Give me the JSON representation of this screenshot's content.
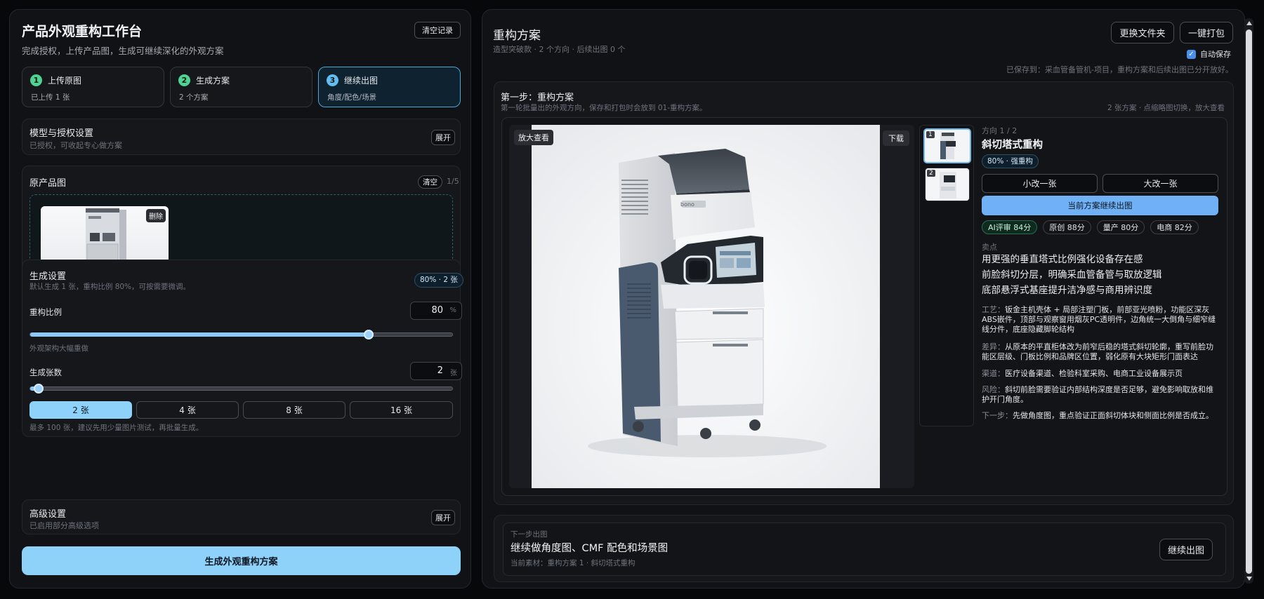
{
  "left": {
    "title": "产品外观重构工作台",
    "subtitle": "完成授权，上传产品图，生成可继续深化的外观方案",
    "clear_history": "清空记录",
    "steps": [
      {
        "num": "1",
        "title": "上传原图",
        "sub": "已上传 1 张"
      },
      {
        "num": "2",
        "title": "生成方案",
        "sub": "2 个方案"
      },
      {
        "num": "3",
        "title": "继续出图",
        "sub": "角度/配色/场景"
      }
    ],
    "model": {
      "title": "模型与授权设置",
      "sub": "已授权，可收起专心做方案",
      "expand": "展开"
    },
    "original": {
      "title": "原产品图",
      "clear": "清空",
      "count": "1/5",
      "delete": "删除"
    },
    "gen": {
      "title": "生成设置",
      "sub": "默认生成 1 张，重构比例 80%，可按需要微调。",
      "badge": "80% · 2 张",
      "ratio_label": "重构比例",
      "ratio_value": "80",
      "ratio_unit": "%",
      "ratio_fraction": 0.8,
      "ratio_hint": "外观架构大幅重做",
      "count_label": "生成张数",
      "count_value": "2",
      "count_unit": "张",
      "count_fraction": 0.02,
      "qty_options": [
        "2 张",
        "4 张",
        "8 张",
        "16 张"
      ],
      "qty_selected": 0,
      "note": "最多 100 张，建议先用少量图片测试，再批量生成。"
    },
    "advanced": {
      "title": "高级设置",
      "sub": "已启用部分高级选项",
      "expand": "展开"
    },
    "generate_button": "生成外观重构方案"
  },
  "right": {
    "title": "重构方案",
    "subtitle": "造型突破款 · 2 个方向 · 后续出图 0 个",
    "change_folder": "更换文件夹",
    "pack": "一键打包",
    "autosave": "自动保存",
    "autosave_checked": true,
    "saved_to": "已保存到：采血管备管机-项目，重构方案和后续出图已分开放好。",
    "step": {
      "title": "第一步：重构方案",
      "sub": "第一轮批量出的外观方向，保存和打包时会放到 01-重构方案。",
      "hint": "2 张方案 · 点缩略图切换，放大查看"
    },
    "viewer": {
      "zoom": "放大查看",
      "download": "下载",
      "thumbs": [
        "1",
        "2"
      ],
      "machine_brand": "bono"
    },
    "detail": {
      "direction": "方向 1 / 2",
      "name": "斜切塔式重构",
      "strength": "80% · 强重构",
      "small_change": "小改一张",
      "big_change": "大改一张",
      "continue": "当前方案继续出图",
      "scores": [
        "AI评审 84分",
        "原创 88分",
        "量产 80分",
        "电商 82分"
      ],
      "selling_label": "卖点",
      "selling": [
        "用更强的垂直塔式比例强化设备存在感",
        "前脸斜切分层，明确采血管备管与取放逻辑",
        "底部悬浮式基座提升洁净感与商用辨识度"
      ],
      "craft_label": "工艺：",
      "craft": "钣金主机壳体 + 局部注塑门板，前部亚光喷粉，功能区深灰ABS嵌件，顶部与观察窗用烟灰PC透明件，边角统一大倒角与细窄缝线分件，底座隐藏脚轮结构",
      "diff_label": "差异：",
      "diff": "从原本的平直柜体改为前窄后稳的塔式斜切轮廓，重写前脸功能区层级、门板比例和品牌区位置，弱化原有大块矩形门面表达",
      "channel_label": "渠道：",
      "channel": "医疗设备渠道、检验科室采购、电商工业设备展示页",
      "risk_label": "风险：",
      "risk": "斜切前脸需要验证内部结构深度是否足够，避免影响取放和维护开门角度。",
      "next_label": "下一步：",
      "next": "先做角度图，重点验证正面斜切体块和侧面比例是否成立。"
    },
    "next_panel": {
      "label": "下一步出图",
      "title": "继续做角度图、CMF 配色和场景图",
      "sub": "当前素材：重构方案 1 · 斜切塔式重构",
      "button": "继续出图"
    }
  }
}
